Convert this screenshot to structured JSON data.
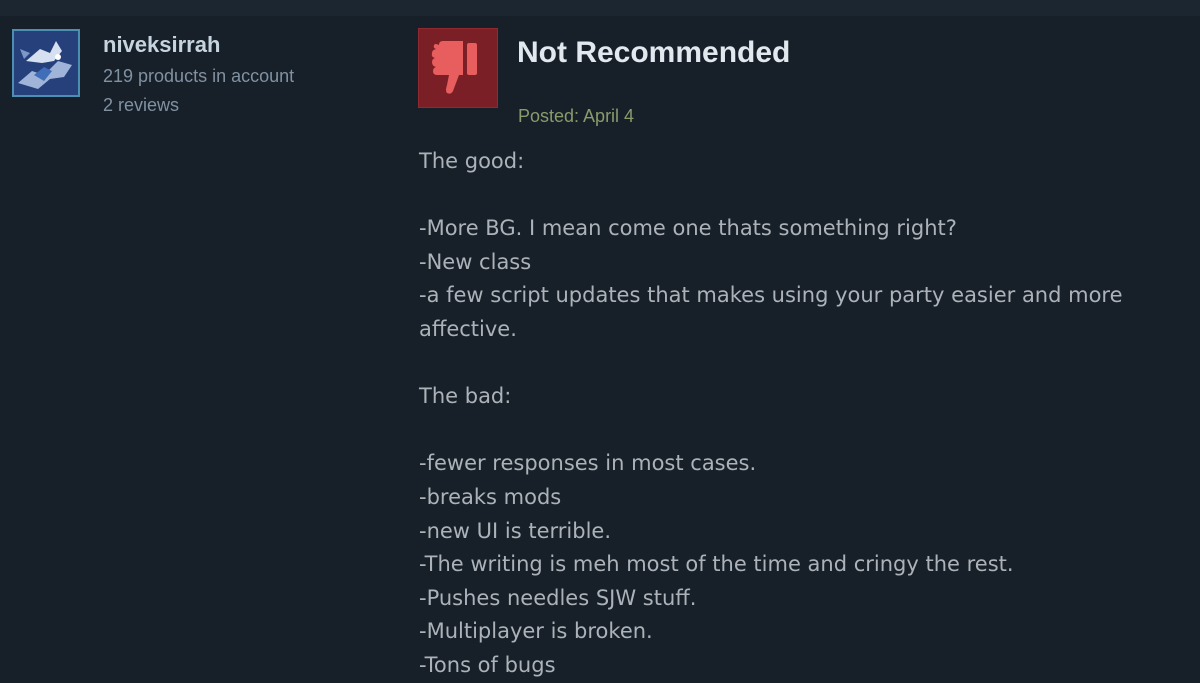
{
  "author": {
    "name": "niveksirrah",
    "products": "219 products in account",
    "reviews": "2 reviews"
  },
  "review": {
    "verdict": "Not Recommended",
    "verdict_icon": "thumbs-down-icon",
    "posted": "Posted: April 4",
    "lines": [
      "The good:",
      "",
      "-More BG. I mean come one thats something right?",
      "-New class",
      "-a few script updates that makes using your party easier and more affective.",
      "",
      "The bad:",
      "",
      "-fewer responses in most cases.",
      "-breaks mods",
      "-new UI is terrible.",
      "-The writing is meh most of the time and cringy the rest.",
      "-Pushes needles SJW stuff.",
      "-Multiplayer is broken.",
      "-Tons of bugs"
    ]
  },
  "colors": {
    "background": "#172029",
    "verdict_bg": "#7a1f26",
    "thumb": "#e85d5d",
    "posted": "#8a9a6b"
  }
}
